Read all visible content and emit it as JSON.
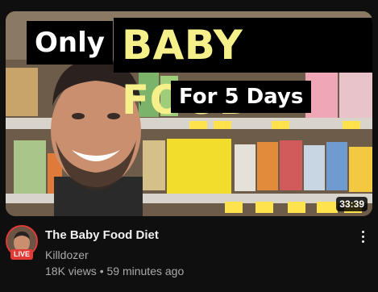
{
  "video": {
    "thumbnail": {
      "line1": "Only",
      "line2": "BABY FOOD",
      "line3": "For 5 Days",
      "duration": "33:39"
    },
    "title": "The Baby Food Diet",
    "channel": "Killdozer",
    "views": "18K views",
    "separator": "•",
    "age": "59 minutes ago",
    "live_badge": "LIVE",
    "menu_icon": "more-vert-icon"
  },
  "colors": {
    "background": "#0f0f0f",
    "live_red": "#e53935",
    "overlay_yellow": "#f6f08a",
    "secondary_text": "#aaaaaa"
  }
}
